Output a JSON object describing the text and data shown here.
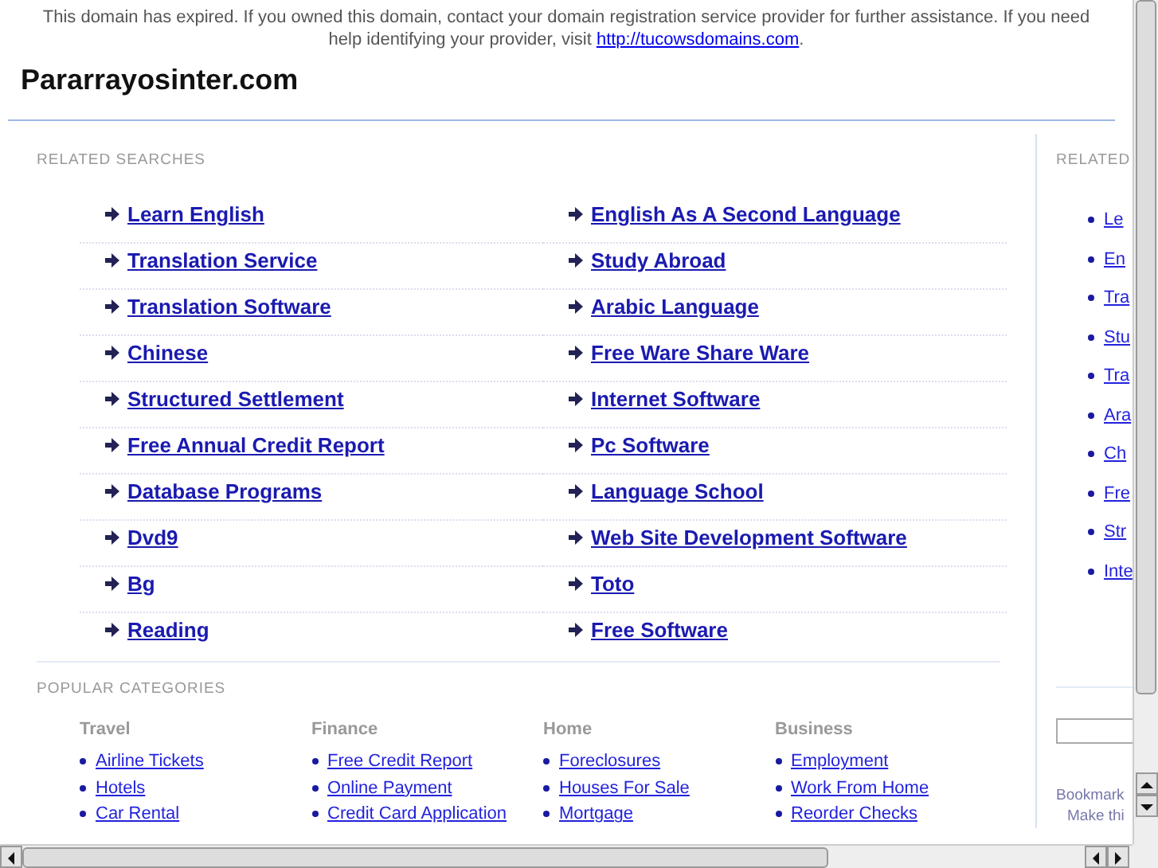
{
  "notice": {
    "text": "This domain has expired. If you owned this domain, contact your domain registration service provider for further assistance. If you need help identifying your provider, visit ",
    "link": "http://tucowsdomains.com",
    "after": "."
  },
  "site_title": "Pararrayosinter.com",
  "related_searches": {
    "title": "RELATED SEARCHES",
    "links": [
      "Learn English",
      "English As A Second Language",
      "Translation Service",
      "Study Abroad",
      "Translation Software",
      "Arabic Language",
      "Chinese",
      "Free Ware Share Ware",
      "Structured Settlement",
      "Internet Software",
      "Free Annual Credit Report",
      "Pc Software",
      "Database Programs",
      "Language School",
      "Dvd9",
      "Web Site Development Software",
      "Bg",
      "Toto",
      "Reading",
      "Free Software"
    ]
  },
  "popular_categories": {
    "title": "POPULAR CATEGORIES",
    "columns": [
      {
        "heading": "Travel",
        "links": [
          "Airline Tickets",
          "Hotels",
          "Car Rental"
        ]
      },
      {
        "heading": "Finance",
        "links": [
          "Free Credit Report",
          "Online Payment",
          "Credit Card Application"
        ]
      },
      {
        "heading": "Home",
        "links": [
          "Foreclosures",
          "Houses For Sale",
          "Mortgage"
        ]
      },
      {
        "heading": "Business",
        "links": [
          "Employment",
          "Work From Home",
          "Reorder Checks"
        ]
      }
    ]
  },
  "sidebar": {
    "title": "RELATED",
    "links": [
      "Le",
      "En",
      "Tra",
      "Stu",
      "Tra",
      "Ara",
      "Ch",
      "Fre",
      "Str",
      "Inte"
    ],
    "bookmark": "Bookmark",
    "make": "Make thi"
  }
}
